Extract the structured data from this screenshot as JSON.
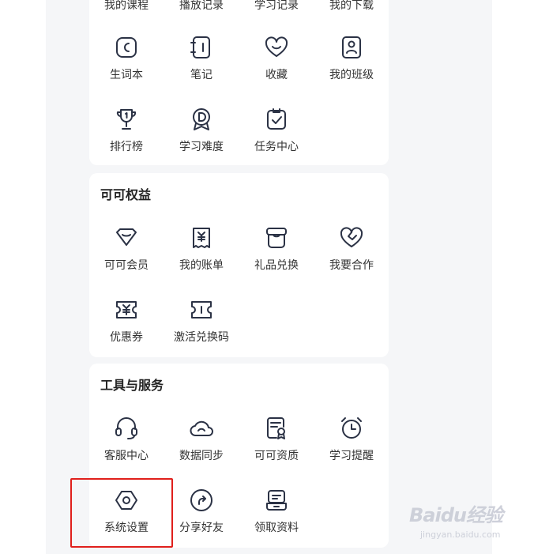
{
  "top_row": [
    "我的课程",
    "播放记录",
    "学习记录",
    "我的下载"
  ],
  "study": {
    "items": [
      {
        "label": "生词本",
        "icon": "vocabulary-book-icon"
      },
      {
        "label": "笔记",
        "icon": "notebook-icon"
      },
      {
        "label": "收藏",
        "icon": "heart-favorite-icon"
      },
      {
        "label": "我的班级",
        "icon": "class-profile-icon"
      },
      {
        "label": "排行榜",
        "icon": "trophy-icon"
      },
      {
        "label": "学习难度",
        "icon": "difficulty-medal-icon"
      },
      {
        "label": "任务中心",
        "icon": "task-clipboard-icon"
      }
    ]
  },
  "benefits": {
    "title": "可可权益",
    "items": [
      {
        "label": "可可会员",
        "icon": "diamond-member-icon"
      },
      {
        "label": "我的账单",
        "icon": "bill-receipt-icon"
      },
      {
        "label": "礼品兑换",
        "icon": "gift-box-icon"
      },
      {
        "label": "我要合作",
        "icon": "handshake-heart-icon"
      },
      {
        "label": "优惠券",
        "icon": "coupon-yen-icon"
      },
      {
        "label": "激活兑换码",
        "icon": "ticket-code-icon"
      }
    ]
  },
  "tools": {
    "title": "工具与服务",
    "items": [
      {
        "label": "客服中心",
        "icon": "headset-icon"
      },
      {
        "label": "数据同步",
        "icon": "cloud-sync-icon"
      },
      {
        "label": "可可资质",
        "icon": "certificate-icon"
      },
      {
        "label": "学习提醒",
        "icon": "alarm-clock-icon"
      },
      {
        "label": "系统设置",
        "icon": "hexagon-settings-icon"
      },
      {
        "label": "分享好友",
        "icon": "share-arrow-icon"
      },
      {
        "label": "领取资料",
        "icon": "materials-stack-icon"
      }
    ]
  },
  "watermark": {
    "brand": "Baidu经验",
    "url": "jingyan.baidu.com"
  },
  "colors": {
    "icon_stroke": "#2b3245",
    "highlight": "#e0201c",
    "page_bg": "#f5f6f8"
  }
}
